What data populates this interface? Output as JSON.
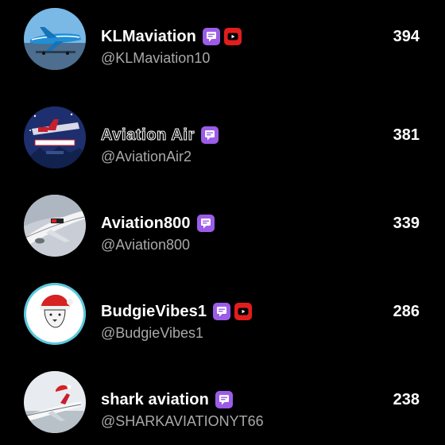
{
  "colors": {
    "background": "#000000",
    "member_badge": "#9c5ce8",
    "youtube_badge": "#e31d1d",
    "handle_text": "#a9a9a9"
  },
  "leaderboard": [
    {
      "name": "KLMaviation",
      "handle": "@KLMaviation10",
      "score": "394",
      "badges": [
        "member-badge-icon",
        "youtube-badge-icon"
      ]
    },
    {
      "name": "Aviation Air",
      "handle": "@AviationAir2",
      "score": "381",
      "badges": [
        "member-badge-icon"
      ]
    },
    {
      "name": "Aviation800",
      "handle": "@Aviation800",
      "score": "339",
      "badges": [
        "member-badge-icon"
      ]
    },
    {
      "name": "BudgieVibes1",
      "handle": "@BudgieVibes1",
      "score": "286",
      "badges": [
        "member-badge-icon",
        "youtube-badge-icon"
      ]
    },
    {
      "name": "shark aviation",
      "handle": "@SHARKAVIATIONYT66",
      "score": "238",
      "badges": [
        "member-badge-icon"
      ]
    }
  ]
}
